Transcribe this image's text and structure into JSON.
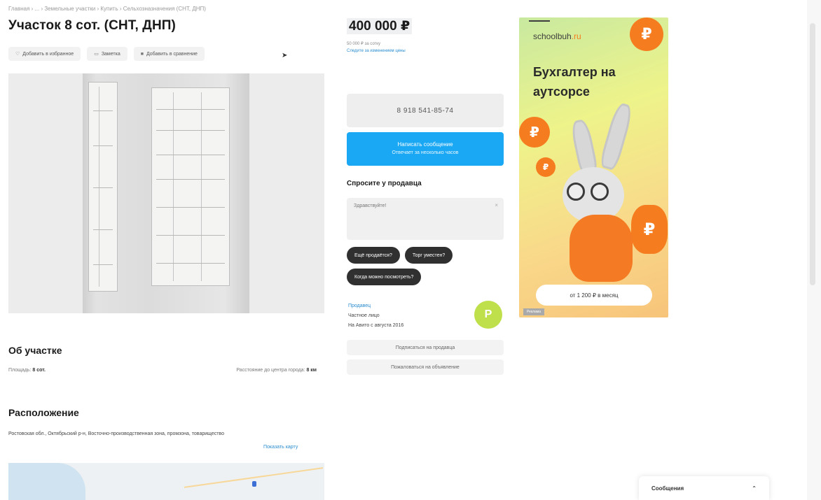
{
  "breadcrumb": "Главная › ... › Земельные участки › Купить › Сельхозназначения (СНТ, ДНП)",
  "listing": {
    "title": "Участок 8 сот. (СНТ, ДНП)",
    "actions": [
      "Добавить в избранное",
      "Заметка",
      "Добавить в сравнение"
    ],
    "about_heading": "Об участке",
    "params": [
      {
        "label": "Площадь:",
        "value": "8 сот."
      },
      {
        "label": "Расстояние до центра города:",
        "value": "8 км"
      }
    ],
    "location_heading": "Расположение",
    "address": "Ростовская обл., Октябрьский р-н, Восточно-производственная зона, промзона, товарищество",
    "map_link": "Показать карту"
  },
  "sidebar": {
    "price": "400 000 ₽",
    "price_note": "50 000 ₽ за сотку",
    "price_link": "Следите за изменением цены",
    "phone": "8 918 541-85-74",
    "message_button": "Написать сообщение",
    "message_sub": "Отвечает за несколько часов",
    "ask_heading": "Спросите у продавца",
    "ask_placeholder": "Здравствуйте!",
    "chips": [
      "Ещё продаётся?",
      "Торг уместен?",
      "Когда можно посмотреть?"
    ],
    "seller": {
      "name": "Продавец",
      "type": "Частное лицо",
      "since": "На Авито с августа 2016"
    },
    "seller_initial": "Р",
    "sub_buttons": [
      "Подписаться на продавца",
      "Пожаловаться на объявление"
    ]
  },
  "ad": {
    "logo": "schoolbuh",
    "logo_accent": ".ru",
    "headline": "Бухгалтер на аутсорсе",
    "cta": "от 1 200 ₽ в месяц",
    "coin_symbol": "₽",
    "badge": "Реклама"
  },
  "messenger": {
    "label": "Сообщения",
    "chevron": "⌃"
  },
  "colors": {
    "accent_blue": "#1aa8f4",
    "chip_dark": "#303030",
    "ad_orange": "#f57c1f",
    "avatar_green": "#bfe04a"
  },
  "icons": [
    "heart-icon",
    "note-icon",
    "compare-icon",
    "close-icon",
    "chevron-up-icon",
    "ruble-coin-icon"
  ]
}
